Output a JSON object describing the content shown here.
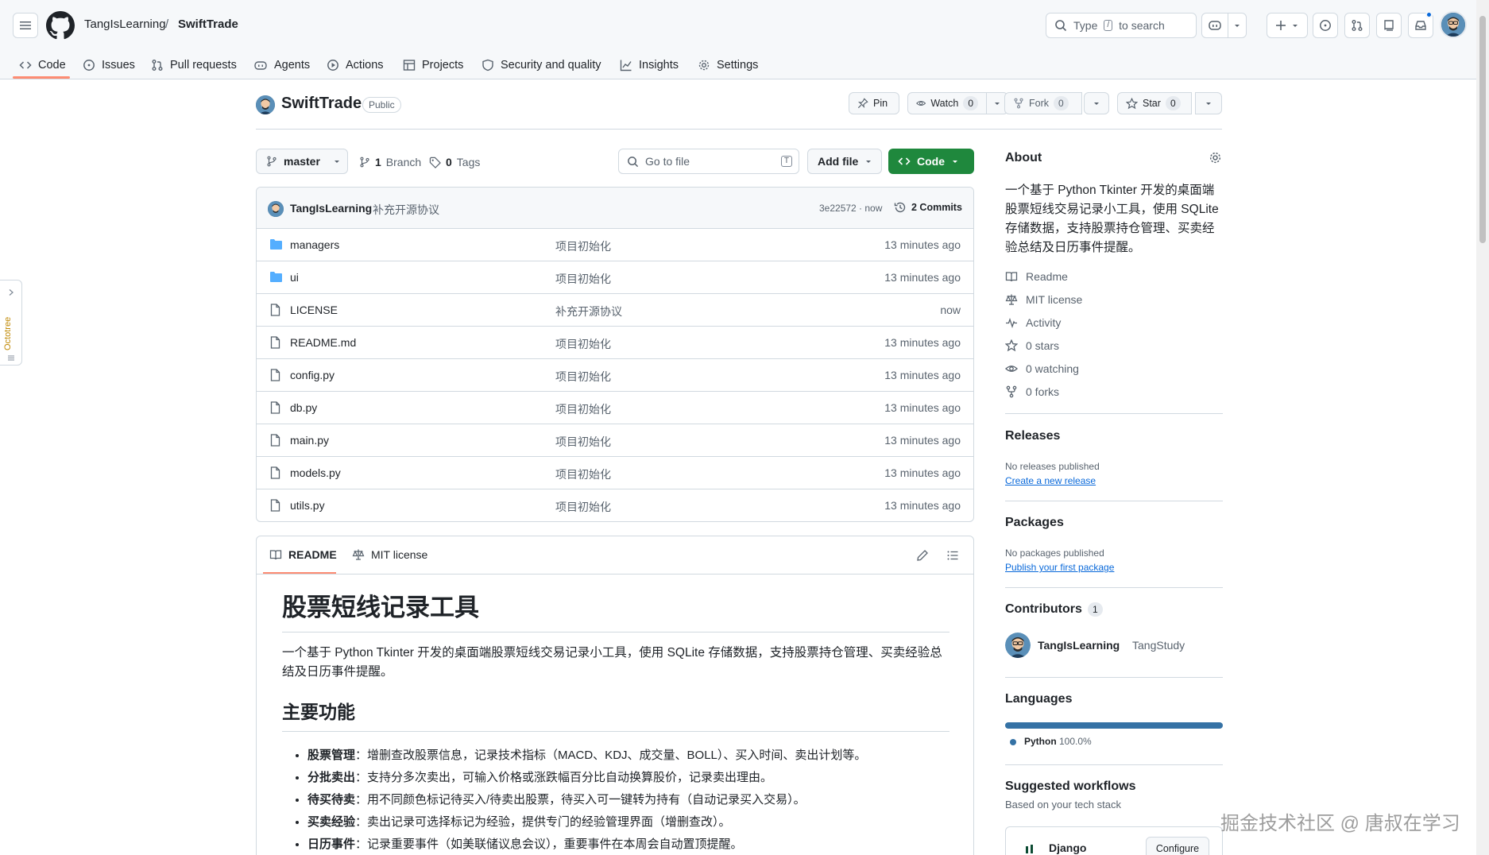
{
  "header": {
    "owner": "TangIsLearning",
    "separator": "/",
    "repo": "SwiftTrade",
    "search": {
      "prefix": "Type",
      "key": "/",
      "suffix": "to search"
    }
  },
  "nav": [
    {
      "label": "Code",
      "icon": "code-icon"
    },
    {
      "label": "Issues",
      "icon": "issue-icon"
    },
    {
      "label": "Pull requests",
      "icon": "pull-request-icon"
    },
    {
      "label": "Agents",
      "icon": "agent-icon"
    },
    {
      "label": "Actions",
      "icon": "play-icon"
    },
    {
      "label": "Projects",
      "icon": "table-icon"
    },
    {
      "label": "Security and quality",
      "icon": "shield-icon"
    },
    {
      "label": "Insights",
      "icon": "graph-icon"
    },
    {
      "label": "Settings",
      "icon": "gear-icon"
    }
  ],
  "repo": {
    "name": "SwiftTrade",
    "visibility": "Public",
    "pin": "Pin",
    "watch": {
      "label": "Watch",
      "count": "0"
    },
    "fork": {
      "label": "Fork",
      "count": "0"
    },
    "star": {
      "label": "Star",
      "count": "0"
    }
  },
  "browser": {
    "branch": "master",
    "branches_count": "1",
    "branches_label": "Branch",
    "tags_count": "0",
    "tags_label": "Tags",
    "goto_placeholder": "Go to file",
    "goto_key": "T",
    "add_file": "Add file",
    "code": "Code"
  },
  "commit": {
    "author": "TangIsLearning",
    "message": "补充开源协议",
    "hash_time": "3e22572 · now",
    "commits": "2 Commits"
  },
  "files": [
    {
      "name": "managers",
      "type": "folder",
      "message": "项目初始化",
      "time": "13 minutes ago"
    },
    {
      "name": "ui",
      "type": "folder",
      "message": "项目初始化",
      "time": "13 minutes ago"
    },
    {
      "name": "LICENSE",
      "type": "file",
      "message": "补充开源协议",
      "time": "now"
    },
    {
      "name": "README.md",
      "type": "file",
      "message": "项目初始化",
      "time": "13 minutes ago"
    },
    {
      "name": "config.py",
      "type": "file",
      "message": "项目初始化",
      "time": "13 minutes ago"
    },
    {
      "name": "db.py",
      "type": "file",
      "message": "项目初始化",
      "time": "13 minutes ago"
    },
    {
      "name": "main.py",
      "type": "file",
      "message": "项目初始化",
      "time": "13 minutes ago"
    },
    {
      "name": "models.py",
      "type": "file",
      "message": "项目初始化",
      "time": "13 minutes ago"
    },
    {
      "name": "utils.py",
      "type": "file",
      "message": "项目初始化",
      "time": "13 minutes ago"
    }
  ],
  "readme": {
    "tab_readme": "README",
    "tab_license": "MIT license",
    "title": "股票短线记录工具",
    "intro": "一个基于 Python Tkinter 开发的桌面端股票短线交易记录小工具，使用 SQLite 存储数据，支持股票持仓管理、买卖经验总结及日历事件提醒。",
    "features_heading": "主要功能",
    "features": [
      {
        "term": "股票管理",
        "text": "：增删查改股票信息，记录技术指标（MACD、KDJ、成交量、BOLL）、买入时间、卖出计划等。"
      },
      {
        "term": "分批卖出",
        "text": "：支持分多次卖出，可输入价格或涨跌幅百分比自动换算股价，记录卖出理由。"
      },
      {
        "term": "待买待卖",
        "text": "：用不同颜色标记待买入/待卖出股票，待买入可一键转为持有（自动记录买入交易）。"
      },
      {
        "term": "买卖经验",
        "text": "：卖出记录可选择标记为经验，提供专门的经验管理界面（增删查改）。"
      },
      {
        "term": "日历事件",
        "text": "：记录重要事件（如美联储议息会议），重要事件在本周会自动置顶提醒。"
      }
    ]
  },
  "about": {
    "heading": "About",
    "description": "一个基于 Python Tkinter 开发的桌面端股票短线交易记录小工具，使用 SQLite 存储数据，支持股票持仓管理、买卖经验总结及日历事件提醒。",
    "links": [
      {
        "label": "Readme",
        "icon": "book-icon"
      },
      {
        "label": "MIT license",
        "icon": "law-icon"
      },
      {
        "label": "Activity",
        "icon": "pulse-icon"
      },
      {
        "label": "0 stars",
        "icon": "star-icon"
      },
      {
        "label": "0 watching",
        "icon": "eye-icon"
      },
      {
        "label": "0 forks",
        "icon": "fork-icon"
      }
    ]
  },
  "releases": {
    "heading": "Releases",
    "empty": "No releases published",
    "link": "Create a new release"
  },
  "packages": {
    "heading": "Packages",
    "empty": "No packages published",
    "link": "Publish your first package"
  },
  "contributors": {
    "heading": "Contributors",
    "count": "1",
    "user": "TangIsLearning",
    "name": "TangStudy"
  },
  "languages": {
    "heading": "Languages",
    "name": "Python",
    "percent": "100.0%",
    "color": "#3572A5",
    "share": 1.0
  },
  "workflows": {
    "heading": "Suggested workflows",
    "subtitle": "Based on your tech stack",
    "item": "Django",
    "configure": "Configure"
  },
  "octotree": "Octotree",
  "watermark": "掘金技术社区 @ 唐叔在学习"
}
